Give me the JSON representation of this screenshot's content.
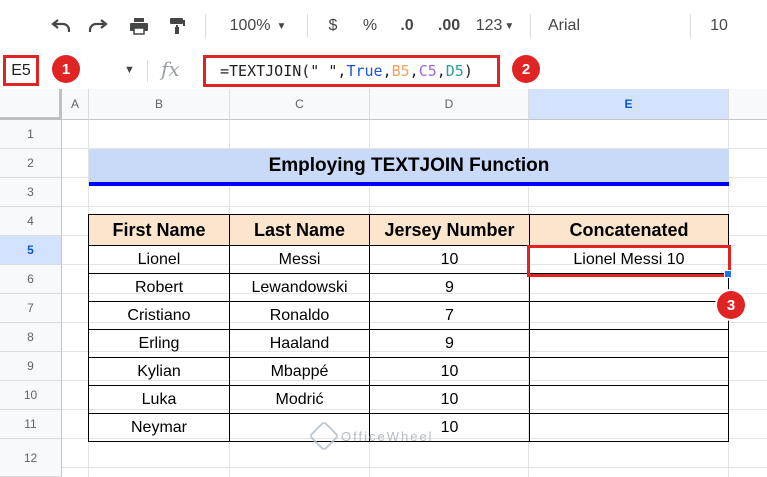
{
  "toolbar": {
    "zoom": "100%",
    "currency": "$",
    "percent": "%",
    "dec_decrease": ".0",
    "dec_increase": ".00",
    "more_formats": "123",
    "font": "Arial",
    "font_size": "10"
  },
  "formula_bar": {
    "name_box": "E5",
    "fx": "fx",
    "formula_prefix": "=TEXTJOIN(\" \",",
    "formula_true": "True",
    "formula_comma1": ",",
    "formula_b5": "B5",
    "formula_comma2": ",",
    "formula_c5": "C5",
    "formula_comma3": ",",
    "formula_d5": "D5",
    "formula_close": ")"
  },
  "callouts": [
    "1",
    "2",
    "3"
  ],
  "columns": [
    "A",
    "B",
    "C",
    "D",
    "E"
  ],
  "rows": [
    "1",
    "2",
    "3",
    "4",
    "5",
    "6",
    "7",
    "8",
    "9",
    "10",
    "11",
    "12"
  ],
  "sheet": {
    "title": "Employing TEXTJOIN Function",
    "headers": [
      "First Name",
      "Last Name",
      "Jersey Number",
      "Concatenated"
    ],
    "data_rows": [
      [
        "Lionel",
        "Messi",
        "10",
        "Lionel Messi 10"
      ],
      [
        "Robert",
        "Lewandowski",
        "9",
        ""
      ],
      [
        "Cristiano",
        "Ronaldo",
        "7",
        ""
      ],
      [
        "Erling",
        "Haaland",
        "9",
        ""
      ],
      [
        "Kylian",
        "Mbappé",
        "10",
        ""
      ],
      [
        "Luka",
        "Modrić",
        "10",
        ""
      ],
      [
        "Neymar",
        "",
        "10",
        ""
      ]
    ]
  },
  "watermark": "OfficeWheel",
  "colors": {
    "accent_red": "#e02424",
    "title_fill": "#c9daf8",
    "header_fill": "#fce5cd",
    "underline_blue": "#0000ff",
    "ref_b5": "#f4a261",
    "ref_c5": "#9c6ade",
    "ref_d5": "#2e9c9c",
    "bool_blue": "#1a55d4"
  }
}
